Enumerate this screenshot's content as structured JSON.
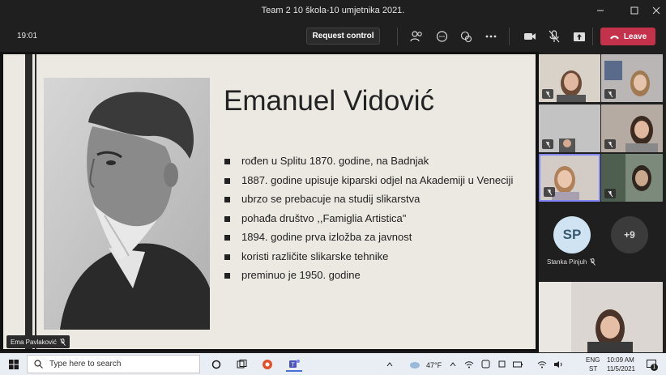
{
  "window": {
    "title": "Team 2 10 škola-10 umjetnika 2021.",
    "controls": [
      "minimize",
      "maximize",
      "close"
    ]
  },
  "call": {
    "timer": "19:01",
    "request_control_label": "Request control",
    "leave_label": "Leave",
    "leave_color": "#c4314b"
  },
  "slide": {
    "title": "Emanuel Vidović",
    "bullets": [
      "rođen u Splitu 1870. godine, na Badnjak",
      "1887. godine upisuje kiparski odjel na Akademiji u Veneciji",
      "ubrzo se prebacuje na studij slikarstva",
      "pohađa društvo ,,Famiglia Artistica\"",
      "1894. godine prva izložba za javnost",
      "koristi različite slikarske tehnike",
      "preminuo je 1950. godine"
    ]
  },
  "presenter": {
    "name": "Ema Pavlaković"
  },
  "participants": {
    "speaker": {
      "initials": "SP",
      "name": "Stanka Pinjuh"
    },
    "overflow_count": "+9"
  },
  "taskbar": {
    "search_placeholder": "Type here to search",
    "weather": "47°F",
    "language": "ENG",
    "region": "ST",
    "time": "10:09 AM",
    "date": "11/5/2021",
    "notifications": "1"
  }
}
